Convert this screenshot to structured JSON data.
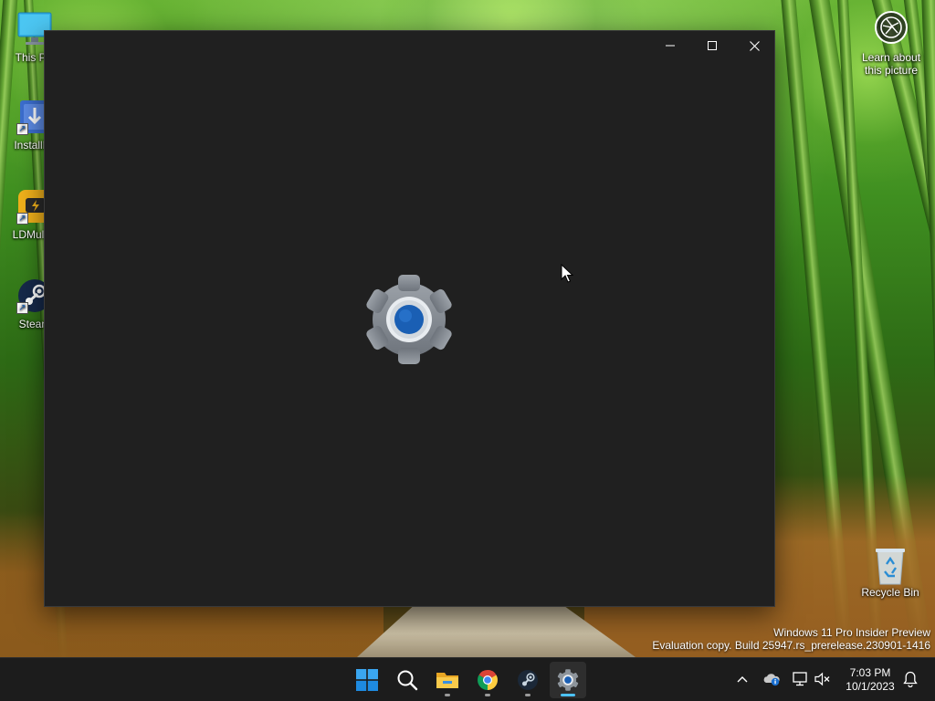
{
  "desktop": {
    "icons": [
      {
        "label": "This PC",
        "icon": "monitor-icon"
      },
      {
        "label": "InstallFo",
        "icon": "installer-icon"
      },
      {
        "label": "LDMultiP",
        "icon": "ldmultiplayer-icon"
      },
      {
        "label": "Steam",
        "icon": "steam-icon"
      },
      {
        "label": "Recycle Bin",
        "icon": "recycle-bin-icon"
      }
    ],
    "spotlight": {
      "line1": "Learn about",
      "line2": "this picture",
      "icon": "camera-aperture-icon"
    },
    "watermark": {
      "line1": "Windows 11 Pro Insider Preview",
      "line2": "Evaluation copy. Build 25947.rs_prerelease.230901-1416"
    }
  },
  "window": {
    "app": "Settings",
    "state": "loading splash",
    "splash_icon": "settings-gear-icon",
    "controls": {
      "minimize": "minimize-icon",
      "maximize": "maximize-icon",
      "close": "close-icon"
    }
  },
  "taskbar": {
    "apps": [
      {
        "name": "Start",
        "icon": "windows-start-icon",
        "running": false,
        "active": false
      },
      {
        "name": "Search",
        "icon": "search-icon",
        "running": false,
        "active": false
      },
      {
        "name": "File Explorer",
        "icon": "folder-icon",
        "running": true,
        "active": false
      },
      {
        "name": "Google Chrome",
        "icon": "chrome-icon",
        "running": true,
        "active": false
      },
      {
        "name": "Steam",
        "icon": "steam-icon",
        "running": true,
        "active": false
      },
      {
        "name": "Settings",
        "icon": "settings-gear-icon",
        "running": true,
        "active": true
      }
    ],
    "tray": {
      "icons": [
        "chevron-up-icon",
        "onedrive-icon",
        "network-icon",
        "volume-muted-icon",
        "notification-bell-icon"
      ],
      "time": "7:03 PM",
      "date": "10/1/2023"
    }
  },
  "colors": {
    "window_bg": "#202020",
    "taskbar_bg": "#1c1c1c",
    "accent": "#4cc2ff",
    "gear_blue": "#1a5fb4"
  }
}
